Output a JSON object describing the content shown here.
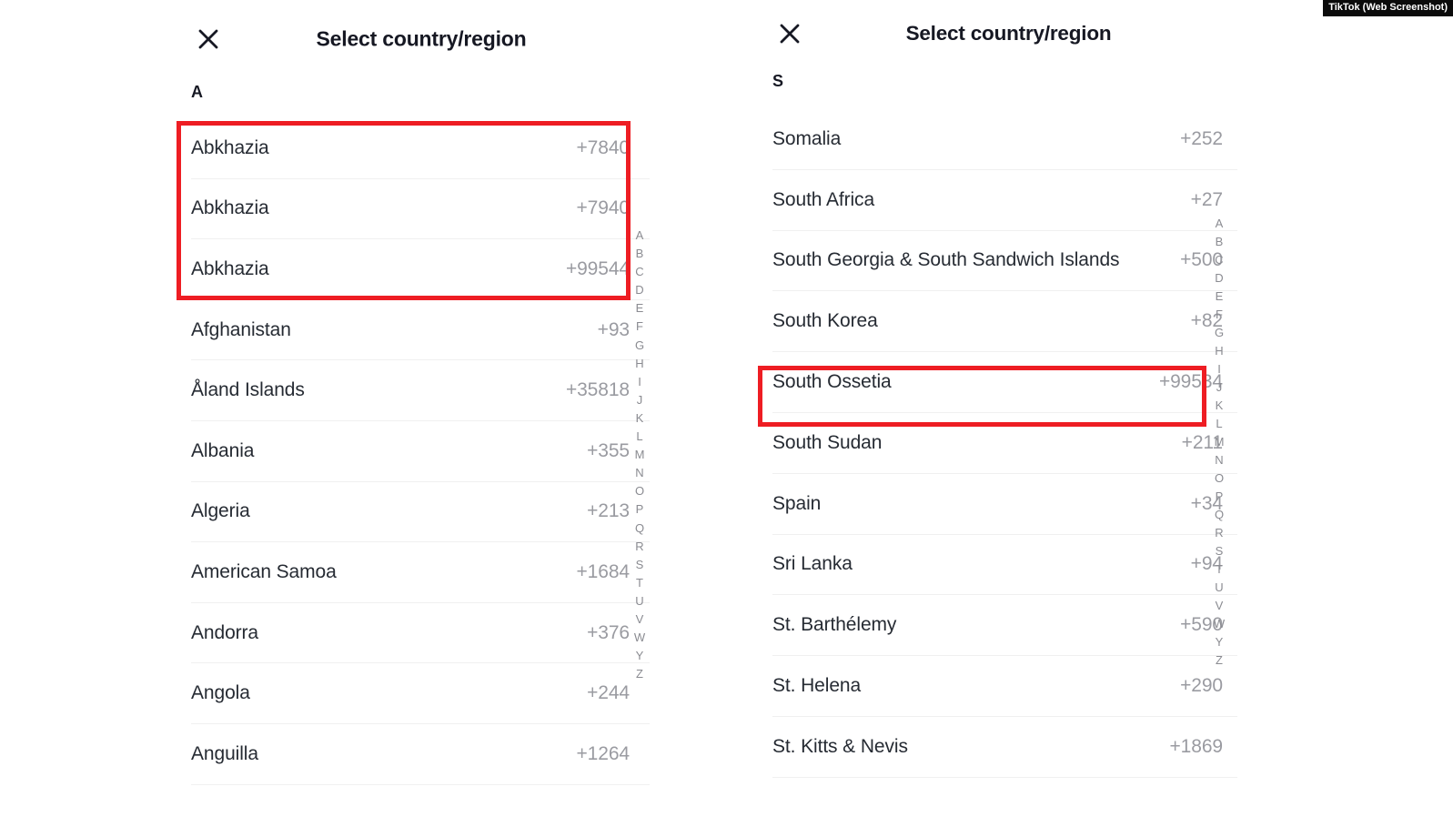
{
  "watermark": {
    "label": "TikTok (Web Screenshot)"
  },
  "colors": {
    "accent_red": "#ee1d23",
    "text_primary": "#262b33",
    "text_secondary": "#9a9ba1",
    "title": "#161823",
    "divider": "#f0f0f0",
    "background": "#ffffff"
  },
  "panels": [
    {
      "id": "left",
      "title": "Select country/region",
      "close_icon": "close-icon",
      "section_letter": "A",
      "alphabet_index": [
        "A",
        "B",
        "C",
        "D",
        "E",
        "F",
        "G",
        "H",
        "I",
        "J",
        "K",
        "L",
        "M",
        "N",
        "O",
        "P",
        "Q",
        "R",
        "S",
        "T",
        "U",
        "V",
        "W",
        "Y",
        "Z"
      ],
      "rows": [
        {
          "name": "Abkhazia",
          "code": "+7840",
          "highlighted": true
        },
        {
          "name": "Abkhazia",
          "code": "+7940",
          "highlighted": true
        },
        {
          "name": "Abkhazia",
          "code": "+99544",
          "highlighted": true
        },
        {
          "name": "Afghanistan",
          "code": "+93",
          "highlighted": false
        },
        {
          "name": "Åland Islands",
          "code": "+35818",
          "highlighted": false
        },
        {
          "name": "Albania",
          "code": "+355",
          "highlighted": false
        },
        {
          "name": "Algeria",
          "code": "+213",
          "highlighted": false
        },
        {
          "name": "American Samoa",
          "code": "+1684",
          "highlighted": false
        },
        {
          "name": "Andorra",
          "code": "+376",
          "highlighted": false
        },
        {
          "name": "Angola",
          "code": "+244",
          "highlighted": false
        },
        {
          "name": "Anguilla",
          "code": "+1264",
          "highlighted": false
        }
      ]
    },
    {
      "id": "right",
      "title": "Select country/region",
      "close_icon": "close-icon",
      "section_letter": "S",
      "alphabet_index": [
        "A",
        "B",
        "C",
        "D",
        "E",
        "F",
        "G",
        "H",
        "I",
        "J",
        "K",
        "L",
        "M",
        "N",
        "O",
        "P",
        "Q",
        "R",
        "S",
        "T",
        "U",
        "V",
        "W",
        "Y",
        "Z"
      ],
      "rows": [
        {
          "name": "Somalia",
          "code": "+252",
          "highlighted": false
        },
        {
          "name": "South Africa",
          "code": "+27",
          "highlighted": false
        },
        {
          "name": "South Georgia & South Sandwich Islands",
          "code": "+500",
          "highlighted": false
        },
        {
          "name": "South Korea",
          "code": "+82",
          "highlighted": false
        },
        {
          "name": "South Ossetia",
          "code": "+99534",
          "highlighted": true
        },
        {
          "name": "South Sudan",
          "code": "+211",
          "highlighted": false
        },
        {
          "name": "Spain",
          "code": "+34",
          "highlighted": false
        },
        {
          "name": "Sri Lanka",
          "code": "+94",
          "highlighted": false
        },
        {
          "name": "St. Barthélemy",
          "code": "+590",
          "highlighted": false
        },
        {
          "name": "St. Helena",
          "code": "+290",
          "highlighted": false
        },
        {
          "name": "St. Kitts & Nevis",
          "code": "+1869",
          "highlighted": false
        }
      ]
    }
  ],
  "annotations": [
    {
      "id": "redbox-left",
      "target": "abkhazia-rows",
      "color": "#ee1d23"
    },
    {
      "id": "redbox-right",
      "target": "south-ossetia-row",
      "color": "#ee1d23"
    }
  ]
}
